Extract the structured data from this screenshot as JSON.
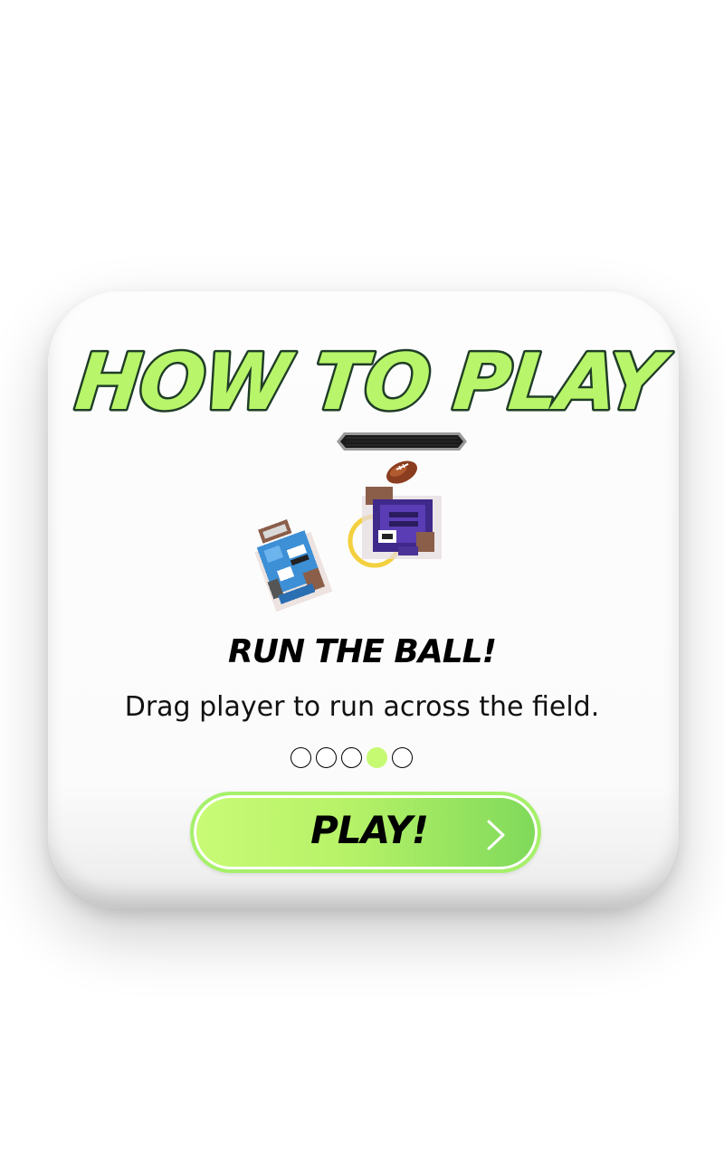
{
  "dialog": {
    "title": "HOW TO PLAY",
    "step_title": "RUN THE BALL!",
    "step_description": "Drag player to run across the field.",
    "play_button_label": "PLAY!",
    "pagination": {
      "total": 5,
      "current": 4
    },
    "illustration_icons": [
      "blue-player-icon",
      "purple-player-icon",
      "football-icon",
      "target-ring-icon"
    ],
    "next_icon": "chevron-right-icon"
  },
  "colors": {
    "title_fill": "#b8f56a",
    "title_outline": "#1f3d26",
    "accent_green": "#c6fa73",
    "button_gradient_start": "#c9fb76",
    "button_gradient_end": "#7fd95a",
    "blue_team": "#3d8fd6",
    "purple_team": "#5a3cb4"
  }
}
